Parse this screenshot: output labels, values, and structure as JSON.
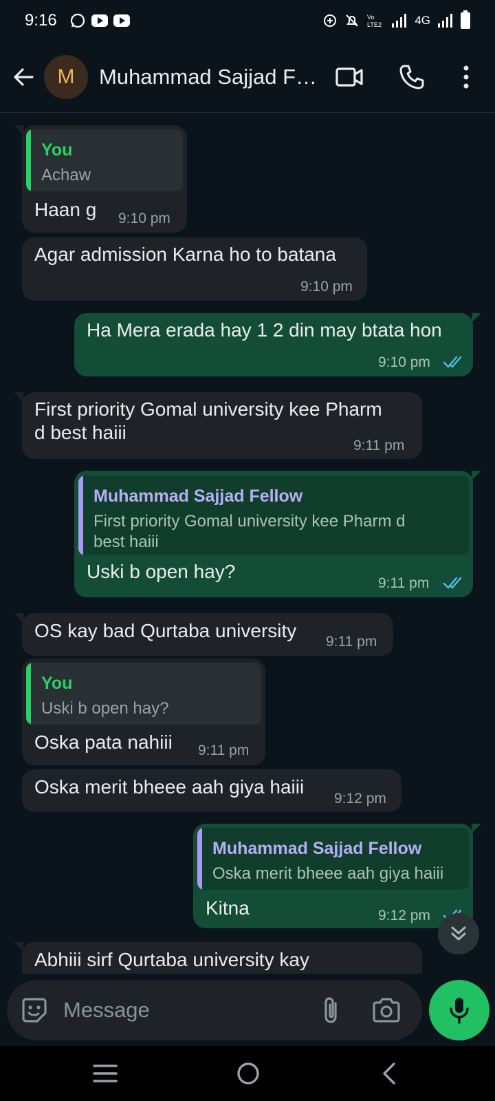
{
  "status_bar": {
    "time": "9:16",
    "network": "4G"
  },
  "header": {
    "avatar_letter": "M",
    "contact_name": "Muhammad Sajjad  Fellow",
    "colors": {
      "avatar_bg": "#3b2b1e",
      "avatar_fg": "#f2b35b"
    }
  },
  "messages": [
    {
      "direction": "incoming",
      "quote_author": "You",
      "quote_text": "Achaw",
      "text": "Haan g",
      "time": "9:10 pm"
    },
    {
      "direction": "incoming",
      "text": "Agar admission Karna ho to batana",
      "time": "9:10 pm"
    },
    {
      "direction": "outgoing",
      "text": "Ha Mera erada hay 1 2 din may btata hon",
      "time": "9:10 pm",
      "status": "read"
    },
    {
      "direction": "incoming",
      "text_line1": "First priority Gomal university kee Pharm",
      "text_line2": "d best haiii",
      "time": "9:11 pm"
    },
    {
      "direction": "outgoing",
      "quote_author": "Muhammad Sajjad  Fellow",
      "quote_line1": "First priority Gomal university kee Pharm d",
      "quote_line2": "best haiii",
      "text": "Uski b open hay?",
      "time": "9:11 pm",
      "status": "read"
    },
    {
      "direction": "incoming",
      "text": "OS kay bad Qurtaba university",
      "time": "9:11 pm"
    },
    {
      "direction": "incoming",
      "quote_author": "You",
      "quote_text": "Uski b open hay?",
      "text": "Oska pata nahiii",
      "time": "9:11 pm"
    },
    {
      "direction": "incoming",
      "text": "Oska merit bheee aah giya haiii",
      "time": "9:12 pm"
    },
    {
      "direction": "outgoing",
      "quote_author": "Muhammad Sajjad  Fellow",
      "quote_text": "Oska merit bheee aah giya haiii",
      "text": "Kitna",
      "time": "9:12 pm",
      "status": "read"
    },
    {
      "direction": "incoming",
      "text": "Abhiii sirf Qurtaba university kay"
    }
  ],
  "composer": {
    "placeholder": "Message"
  },
  "colors": {
    "background": "#0b141a",
    "incoming_bubble": "#1f2327",
    "outgoing_bubble": "#144d37",
    "quote_you": "#25d366",
    "quote_contact": "#a99cf0",
    "read_ticks": "#53bdeb",
    "mic_button": "#21c063"
  }
}
